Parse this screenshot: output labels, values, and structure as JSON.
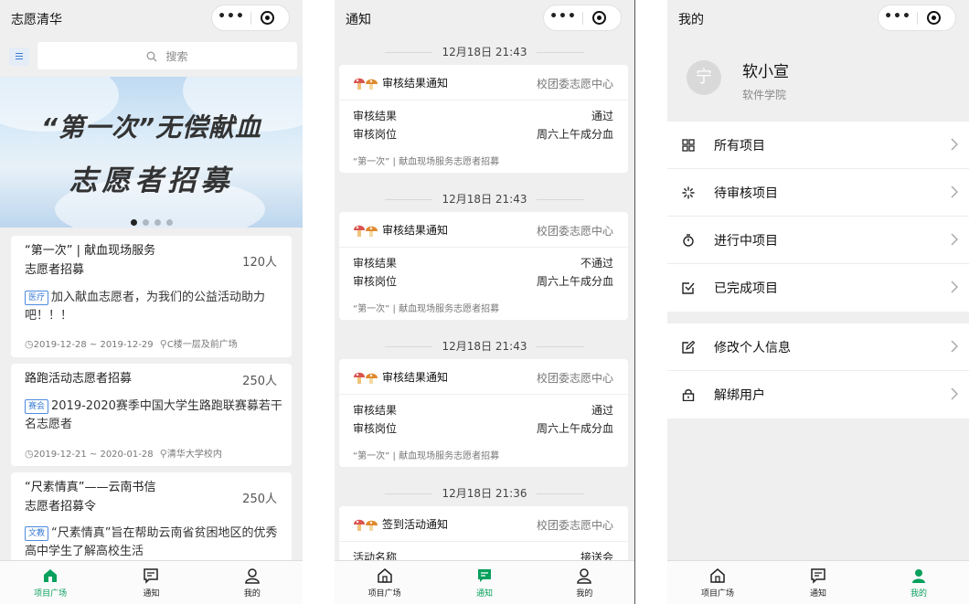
{
  "colors": {
    "accent": "#07a05c",
    "tag_blue": "#3a7bd5",
    "background": "#efefef"
  },
  "capsule": {
    "more": "•••",
    "more_icon": "more-dots-icon",
    "close_icon": "target-circle-icon"
  },
  "tabbar": {
    "items": [
      {
        "label": "项目广场",
        "icon": "home-icon"
      },
      {
        "label": "通知",
        "icon": "message-icon"
      },
      {
        "label": "我的",
        "icon": "user-icon"
      }
    ]
  },
  "screen1": {
    "title": "志愿清华",
    "search": {
      "placeholder": "搜索"
    },
    "banner": {
      "line1": "“第一次”无偿献血",
      "line2": "志愿者招募",
      "slides": 4,
      "active_slide": 1
    },
    "cards": [
      {
        "title_line1": "“第一次” | 献血现场服务",
        "title_line2": "志愿者招募",
        "count": "120人",
        "tag": "医疗",
        "desc": "加入献血志愿者，为我们的公益活动助力吧！！！",
        "date": "2019-12-28 ~ 2019-12-29",
        "location": "C楼一层及前广场"
      },
      {
        "title_line1": "路跑活动志愿者招募",
        "title_line2": "",
        "count": "250人",
        "tag": "赛会",
        "desc": "2019-2020赛季中国大学生路跑联赛募若干名志愿者",
        "date": "2019-12-21 ~ 2020-01-28",
        "location": "清华大学校内"
      },
      {
        "title_line1": "“尺素情真”——云南书信",
        "title_line2": "志愿者招募令",
        "count": "250人",
        "tag": "文教",
        "desc": "“尺素情真”旨在帮助云南省贫困地区的优秀高中学生了解高校生活",
        "date": "",
        "location": ""
      }
    ],
    "active_tab": 0
  },
  "screen2": {
    "title": "通知",
    "notifications": [
      {
        "time": "12月18日 21:43",
        "type": "审核结果通知",
        "source": "校团委志愿中心",
        "row1_label": "审核结果",
        "row1_value": "通过",
        "row2_label": "审核岗位",
        "row2_value": "周六上午成分血",
        "footer": "“第一次” | 献血现场服务志愿者招募"
      },
      {
        "time": "12月18日 21:43",
        "type": "审核结果通知",
        "source": "校团委志愿中心",
        "row1_label": "审核结果",
        "row1_value": "不通过",
        "row2_label": "审核岗位",
        "row2_value": "周六上午成分血",
        "footer": "“第一次” | 献血现场服务志愿者招募"
      },
      {
        "time": "12月18日 21:43",
        "type": "审核结果通知",
        "source": "校团委志愿中心",
        "row1_label": "审核结果",
        "row1_value": "通过",
        "row2_label": "审核岗位",
        "row2_value": "周六上午成分血",
        "footer": "“第一次” | 献血现场服务志愿者招募"
      },
      {
        "time": "12月18日 21:36",
        "type": "签到活动通知",
        "source": "校团委志愿中心",
        "row1_label": "活动名称",
        "row1_value": "接送会",
        "row2_label": "",
        "row2_value": "",
        "footer": ""
      }
    ],
    "active_tab": 1
  },
  "screen3": {
    "title": "我的",
    "profile": {
      "avatar_text": "宁",
      "name": "软小宣",
      "school": "软件学院"
    },
    "menu_group1": [
      {
        "label": "所有项目",
        "icon": "grid-icon"
      },
      {
        "label": "待审核项目",
        "icon": "loading-icon"
      },
      {
        "label": "进行中项目",
        "icon": "stopwatch-icon"
      },
      {
        "label": "已完成项目",
        "icon": "check-square-icon"
      }
    ],
    "menu_group2": [
      {
        "label": "修改个人信息",
        "icon": "edit-icon"
      },
      {
        "label": "解绑用户",
        "icon": "lock-icon"
      }
    ],
    "active_tab": 2
  }
}
